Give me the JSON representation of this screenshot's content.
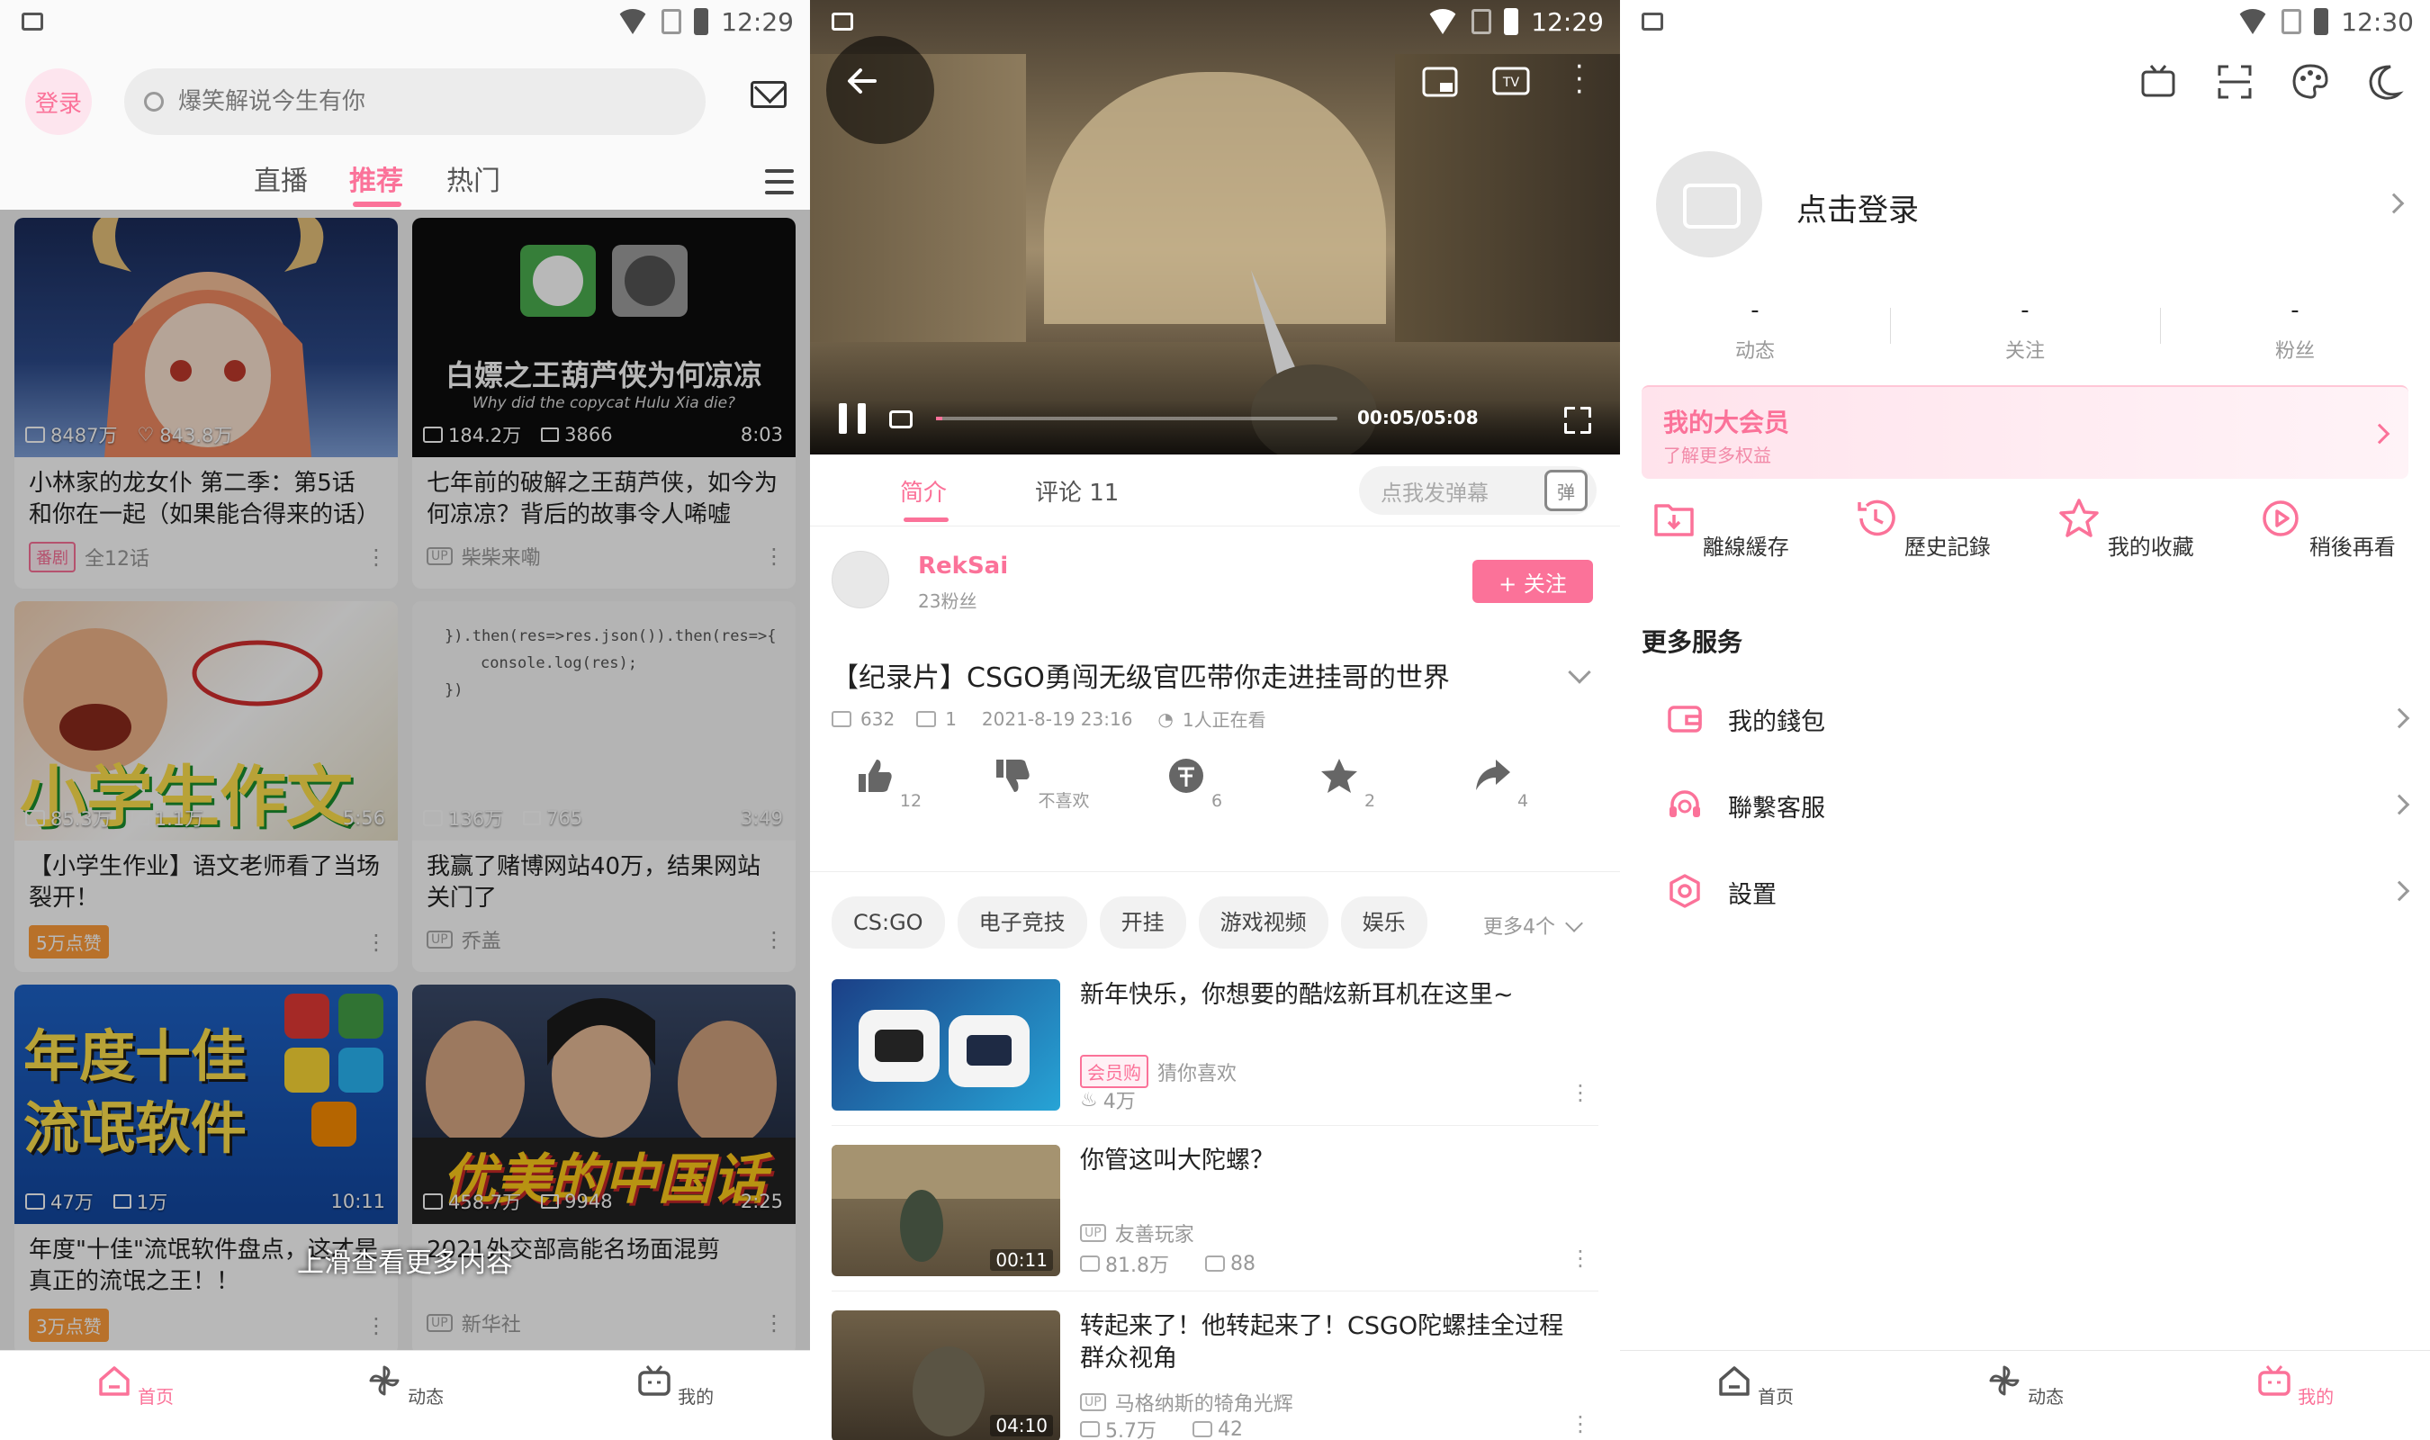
{
  "status": {
    "screen1_time": "12:29",
    "screen2_time": "12:29",
    "screen3_time": "12:30"
  },
  "colors": {
    "accent": "#fb7299"
  },
  "home": {
    "login_label": "登录",
    "search_placeholder": "爆笑解说今生有你",
    "tabs": [
      "直播",
      "推荐",
      "热门"
    ],
    "active_tab": "推荐",
    "more_tip": "上滑查看更多内容",
    "cards": [
      {
        "views": "8487万",
        "stat2": "843.8万",
        "duration": "",
        "title": "小林家的龙女仆 第二季：第5话 和你在一起（如果能合得来的话）",
        "badge": "番剧",
        "foot": "全12话"
      },
      {
        "views": "184.2万",
        "stat2": "3866",
        "duration": "8:03",
        "title": "七年前的破解之王葫芦侠，如今为何凉凉？背后的故事令人唏嘘",
        "badge": "UP",
        "foot": "柴柴来嘞",
        "thumb_text": "白嫖之王葫芦侠为何凉凉",
        "thumb_sub": "Why did the copycat Hulu Xia die?"
      },
      {
        "views": "85.3万",
        "stat2": "1.1万",
        "duration": "5:56",
        "title": "【小学生作业】语文老师看了当场裂开！",
        "badge": "5万点赞",
        "foot": "",
        "thumb_text": "小学生作文"
      },
      {
        "views": "136万",
        "stat2": "765",
        "duration": "3:49",
        "title": "我赢了赌博网站40万，结果网站关门了",
        "badge": "UP",
        "foot": "乔盖",
        "thumb_code": [
          "}).then(res=>res.json()).then(res=>{",
          "console.log(res);",
          "})"
        ]
      },
      {
        "views": "47万",
        "stat2": "1万",
        "duration": "10:11",
        "title": "年度\"十佳\"流氓软件盘点，这才是真正的流氓之王！！",
        "badge": "3万点赞",
        "foot": "",
        "thumb_text": "年度十佳流氓软件"
      },
      {
        "views": "458.7万",
        "stat2": "9948",
        "duration": "2:25",
        "title": "2021外交部高能名场面混剪",
        "badge": "UP",
        "foot": "新华社",
        "thumb_text": "优美的中国话"
      }
    ],
    "nav": [
      "首页",
      "动态",
      "我的"
    ]
  },
  "player": {
    "time": "00:05/05:08",
    "progress": 0.016,
    "tabs": [
      "简介",
      "评论 11"
    ],
    "danmu_placeholder": "点我发弹幕",
    "danmu_btn": "弹",
    "up_name": "RekSai",
    "up_fans": "23粉丝",
    "follow_label": "+ 关注",
    "title": "【纪录片】CSGO勇闯无级官匹带你走进挂哥的世界",
    "meta": {
      "plays": "632",
      "danmaku": "1",
      "date": "2021-8-19 23:16",
      "watching": "1人正在看"
    },
    "actions": [
      {
        "icon": "thumbs-up-icon",
        "label": "12"
      },
      {
        "icon": "thumbs-down-icon",
        "label": "不喜欢"
      },
      {
        "icon": "coin-icon",
        "label": "6"
      },
      {
        "icon": "star-icon",
        "label": "2"
      },
      {
        "icon": "share-icon",
        "label": "4"
      }
    ],
    "tags": [
      "CS:GO",
      "电子竞技",
      "开挂",
      "游戏视频",
      "娱乐"
    ],
    "tags_more": "更多4个",
    "related": [
      {
        "title": "新年快乐，你想要的酷炫新耳机在这里~",
        "badge": "会员购",
        "up": "猜你喜欢",
        "views": "4万",
        "stat2": "",
        "duration": ""
      },
      {
        "title": "你管这叫大陀螺？",
        "badge": "UP",
        "up": "友善玩家",
        "views": "81.8万",
        "stat2": "88",
        "duration": "00:11"
      },
      {
        "title": "转起来了！他转起来了！CSGO陀螺挂全过程群众视角",
        "badge": "UP",
        "up": "马格纳斯的犄角光辉",
        "views": "5.7万",
        "stat2": "42",
        "duration": "04:10"
      }
    ]
  },
  "mine": {
    "login_text": "点击登录",
    "stats": [
      {
        "value": "-",
        "label": "动态"
      },
      {
        "value": "-",
        "label": "关注"
      },
      {
        "value": "-",
        "label": "粉丝"
      }
    ],
    "vip_title": "我的大会员",
    "vip_sub": "了解更多权益",
    "quick": [
      "離線緩存",
      "歷史記錄",
      "我的收藏",
      "稍後再看"
    ],
    "more_services": "更多服务",
    "services": [
      "我的錢包",
      "聯繫客服",
      "設置"
    ],
    "nav": [
      "首页",
      "动态",
      "我的"
    ]
  }
}
